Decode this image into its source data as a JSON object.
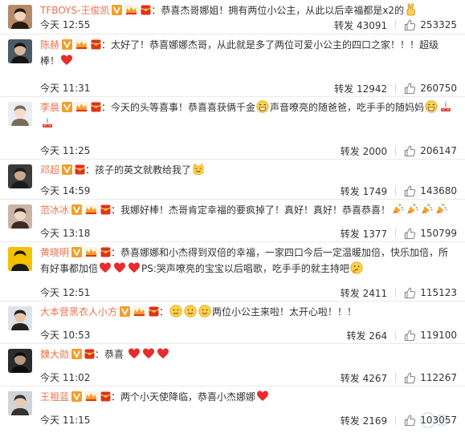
{
  "labels": {
    "repost": "转发"
  },
  "colors": {
    "username": "#eb7350",
    "vip": "#f19e2a",
    "badge_red": "#e0321c",
    "heart": "#e62c2c"
  },
  "comments": [
    {
      "user": "TFBOYS-王俊凯",
      "badges": [
        "v-badge",
        "crown-badge",
        "red-packet-badge"
      ],
      "parts": [
        {
          "t": "：恭喜杰哥娜姐！拥有两位小公主，从此以后幸福都是x2的"
        },
        {
          "e": "victory-hand-emoji"
        }
      ],
      "time": "今天 12:55",
      "reposts": "43091",
      "likes": "253325"
    },
    {
      "user": "陈赫",
      "badges": [
        "v-badge",
        "crown-badge",
        "red-packet-badge"
      ],
      "parts": [
        {
          "t": "：太好了！恭喜娜娜杰哥，从此就是多了两位可爱小公主的四口之家！！！超级棒！"
        },
        {
          "e": "heart-emoji"
        }
      ],
      "time": "今天 11:31",
      "reposts": "12942",
      "likes": "260750"
    },
    {
      "user": "李晨",
      "badges": [
        "v-badge",
        "crown-badge",
        "red-packet-badge"
      ],
      "parts": [
        {
          "t": "：今天的头等喜事！恭喜喜获俩千金"
        },
        {
          "e": "laughing-emoji"
        },
        {
          "t": "声音嘹亮的随爸爸，吃手手的随妈妈"
        },
        {
          "e": "laughing-emoji"
        },
        {
          "e": "cake-emoji"
        },
        {
          "e": "cake-emoji"
        }
      ],
      "time": "今天 11:25",
      "reposts": "2000",
      "likes": "206147"
    },
    {
      "user": "邓超",
      "badges": [
        "v-badge",
        "red-packet-badge"
      ],
      "parts": [
        {
          "t": "：孩子的英文就教给我了"
        },
        {
          "e": "cat-face-emoji"
        }
      ],
      "time": "今天 14:59",
      "reposts": "1749",
      "likes": "143680"
    },
    {
      "user": "范冰冰",
      "badges": [
        "v-badge",
        "crown-badge",
        "red-packet-badge"
      ],
      "parts": [
        {
          "t": "：我娜好棒！杰哥肯定幸福的要疯掉了！真好！真好！恭喜恭喜！"
        },
        {
          "e": "party-popper-emoji"
        },
        {
          "e": "party-popper-emoji"
        },
        {
          "e": "party-popper-emoji"
        },
        {
          "e": "party-popper-emoji"
        }
      ],
      "time": "今天 13:18",
      "reposts": "1377",
      "likes": "150799"
    },
    {
      "user": "黄晓明",
      "badges": [
        "v-badge",
        "crown-badge",
        "red-packet-badge"
      ],
      "parts": [
        {
          "t": "：恭喜娜娜和小杰得到双倍的幸福，一家四口今后一定温暖加倍，快乐加倍，所有好事都加倍"
        },
        {
          "e": "heart-emoji"
        },
        {
          "e": "heart-emoji"
        },
        {
          "e": "heart-emoji"
        },
        {
          "t": "PS:哭声嘹亮的宝宝以后唱歌，吃手手的就主持吧"
        },
        {
          "e": "thinking-emoji"
        }
      ],
      "time": "今天 12:51",
      "reposts": "2411",
      "likes": "115123"
    },
    {
      "user": "大本营黑衣人小方",
      "badges": [
        "v-badge",
        "crown-badge",
        "red-packet-badge"
      ],
      "parts": [
        {
          "t": "："
        },
        {
          "e": "smile-emoji"
        },
        {
          "e": "smile-emoji"
        },
        {
          "e": "smile-emoji"
        },
        {
          "t": "两位小公主来啦！太开心啦！！！"
        }
      ],
      "time": "今天 10:53",
      "reposts": "264",
      "likes": "119100"
    },
    {
      "user": "魏大勋",
      "badges": [
        "v-badge",
        "red-packet-badge"
      ],
      "parts": [
        {
          "t": "：恭喜 "
        },
        {
          "e": "heart-emoji"
        },
        {
          "e": "heart-emoji"
        },
        {
          "e": "heart-emoji"
        }
      ],
      "time": "今天 11:02",
      "reposts": "4267",
      "likes": "112267"
    },
    {
      "user": "王祖蓝",
      "badges": [
        "v-badge",
        "crown-badge",
        "red-packet-badge"
      ],
      "parts": [
        {
          "t": "：两个小天使降临，恭喜小杰娜娜"
        },
        {
          "e": "heart-emoji"
        }
      ],
      "time": "今天 11:15",
      "reposts": "2169",
      "likes": "103057"
    }
  ]
}
